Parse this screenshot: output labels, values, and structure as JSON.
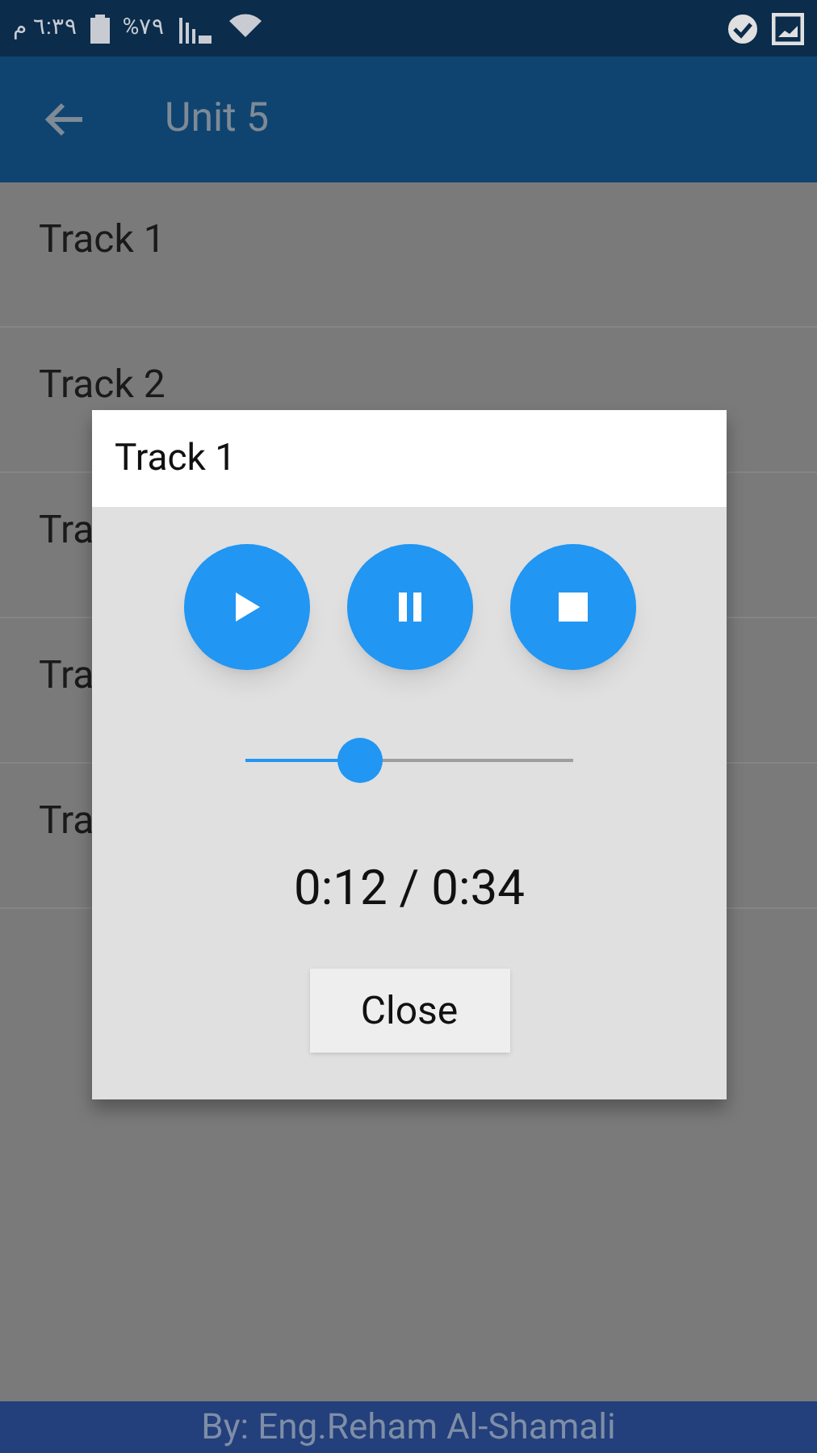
{
  "status_bar": {
    "time": "٦:٣٩ م",
    "battery": "%٧٩"
  },
  "app_bar": {
    "title": "Unit 5"
  },
  "tracks": [
    {
      "label": "Track 1"
    },
    {
      "label": "Track 2"
    },
    {
      "label": "Tra"
    },
    {
      "label": "Tra"
    },
    {
      "label": "Tra"
    }
  ],
  "dialog": {
    "title": "Track 1",
    "controls": [
      {
        "kind": "play"
      },
      {
        "kind": "pause"
      },
      {
        "kind": "stop"
      }
    ],
    "progress": {
      "level": 0.35
    },
    "time": "0:12 / 0:34",
    "close": "Close"
  },
  "footer": "By: Eng.Reham Al-Shamali"
}
